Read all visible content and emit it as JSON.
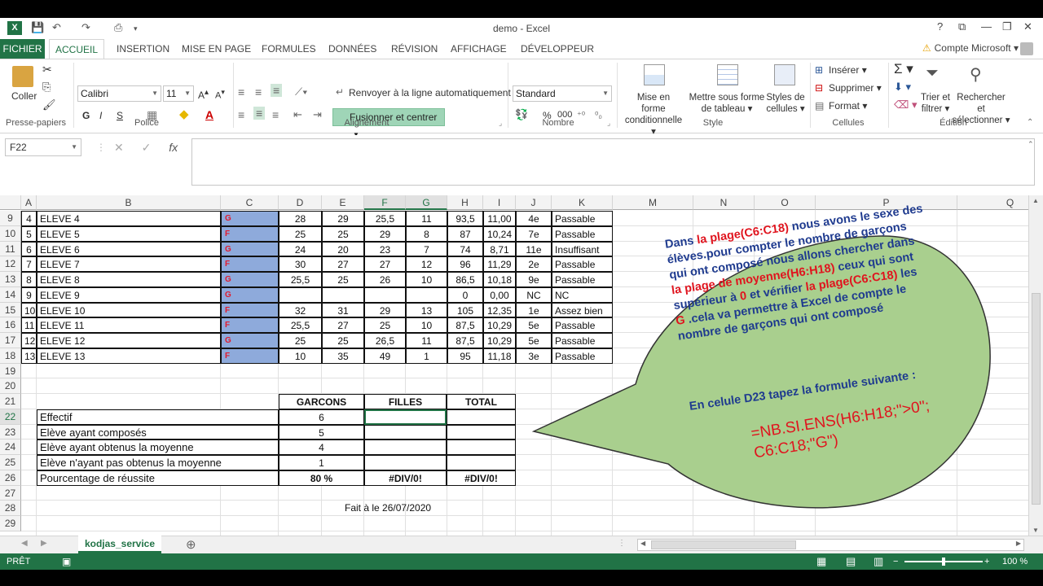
{
  "window": {
    "title": "demo - Excel",
    "help": "?",
    "min": "—",
    "restore": "❐",
    "close": "✕"
  },
  "tabs": {
    "file": "FICHIER",
    "items": [
      "ACCUEIL",
      "INSERTION",
      "MISE EN PAGE",
      "FORMULES",
      "DONNÉES",
      "RÉVISION",
      "AFFICHAGE",
      "DÉVELOPPEUR"
    ],
    "account": "Compte Microsoft"
  },
  "ribbon": {
    "paste": "Coller",
    "font_name": "Calibri",
    "font_size": "11",
    "bold": "G",
    "italic": "I",
    "underline": "S",
    "wrap": "Renvoyer à la ligne automatiquement",
    "merge": "Fusionner et centrer",
    "number_format": "Standard",
    "percent": "%",
    "thousands": "000",
    "cond_format_1": "Mise en forme",
    "cond_format_2": "conditionnelle",
    "table_format_1": "Mettre sous forme",
    "table_format_2": "de tableau",
    "cell_styles_1": "Styles de",
    "cell_styles_2": "cellules",
    "insert": "Insérer",
    "delete": "Supprimer",
    "format": "Format",
    "sort_1": "Trier et",
    "sort_2": "filtrer",
    "find_1": "Rechercher et",
    "find_2": "sélectionner",
    "groups": {
      "clipboard": "Presse-papiers",
      "font": "Police",
      "alignment": "Alignement",
      "number": "Nombre",
      "style": "Style",
      "cells": "Cellules",
      "editing": "Édition"
    }
  },
  "formula_bar": {
    "name_box": "F22",
    "fx": "fx",
    "content": ""
  },
  "columns": [
    "A",
    "B",
    "C",
    "D",
    "E",
    "F",
    "G",
    "H",
    "I",
    "J",
    "K",
    "M",
    "N",
    "O",
    "P",
    "Q"
  ],
  "rows": [
    {
      "n": "9",
      "a": "4",
      "b": "ELEVE 4",
      "c": "G",
      "d": "28",
      "e": "29",
      "f": "25,5",
      "g": "11",
      "h": "93,5",
      "i": "11,00",
      "j": "4e",
      "k": "Passable"
    },
    {
      "n": "10",
      "a": "5",
      "b": "ELEVE 5",
      "c": "F",
      "d": "25",
      "e": "25",
      "f": "29",
      "g": "8",
      "h": "87",
      "i": "10,24",
      "j": "7e",
      "k": "Passable"
    },
    {
      "n": "11",
      "a": "6",
      "b": "ELEVE 6",
      "c": "G",
      "d": "24",
      "e": "20",
      "f": "23",
      "g": "7",
      "h": "74",
      "i": "8,71",
      "j": "11e",
      "k": "Insuffisant"
    },
    {
      "n": "12",
      "a": "7",
      "b": "ELEVE 7",
      "c": "F",
      "d": "30",
      "e": "27",
      "f": "27",
      "g": "12",
      "h": "96",
      "i": "11,29",
      "j": "2e",
      "k": "Passable"
    },
    {
      "n": "13",
      "a": "8",
      "b": "ELEVE 8",
      "c": "G",
      "d": "25,5",
      "e": "25",
      "f": "26",
      "g": "10",
      "h": "86,5",
      "i": "10,18",
      "j": "9e",
      "k": "Passable"
    },
    {
      "n": "14",
      "a": "9",
      "b": "ELEVE 9",
      "c": "G",
      "d": "",
      "e": "",
      "f": "",
      "g": "",
      "h": "0",
      "i": "0,00",
      "j": "NC",
      "k": "NC"
    },
    {
      "n": "15",
      "a": "10",
      "b": "ELEVE 10",
      "c": "F",
      "d": "32",
      "e": "31",
      "f": "29",
      "g": "13",
      "h": "105",
      "i": "12,35",
      "j": "1e",
      "k": "Assez bien"
    },
    {
      "n": "16",
      "a": "11",
      "b": "ELEVE 11",
      "c": "F",
      "d": "25,5",
      "e": "27",
      "f": "25",
      "g": "10",
      "h": "87,5",
      "i": "10,29",
      "j": "5e",
      "k": "Passable"
    },
    {
      "n": "17",
      "a": "12",
      "b": "ELEVE 12",
      "c": "G",
      "d": "25",
      "e": "25",
      "f": "26,5",
      "g": "11",
      "h": "87,5",
      "i": "10,29",
      "j": "5e",
      "k": "Passable"
    },
    {
      "n": "18",
      "a": "13",
      "b": "ELEVE 13",
      "c": "F",
      "d": "10",
      "e": "35",
      "f": "49",
      "g": "1",
      "h": "95",
      "i": "11,18",
      "j": "3e",
      "k": "Passable"
    }
  ],
  "extra_rows": [
    "19",
    "20",
    "21",
    "22",
    "23",
    "24",
    "25",
    "26",
    "27",
    "28",
    "29"
  ],
  "summary": {
    "headers": [
      "GARCONS",
      "FILLES",
      "TOTAL"
    ],
    "rows": [
      {
        "label": "Effectif",
        "g": "6",
        "f": "",
        "t": ""
      },
      {
        "label": "Elève ayant composés",
        "g": "5",
        "f": "",
        "t": ""
      },
      {
        "label": "Elève ayant obtenus la moyenne",
        "g": "4",
        "f": "",
        "t": ""
      },
      {
        "label": "Elève n'ayant pas obtenus la moyenne",
        "g": "1",
        "f": "",
        "t": ""
      },
      {
        "label": "Pourcentage de réussite",
        "g": "80 %",
        "f": "#DIV/0!",
        "t": "#DIV/0!"
      }
    ],
    "footer": "Fait à   le 26/07/2020"
  },
  "bubble": {
    "line1a": "Dans ",
    "line1b": "la plage(C6:C18)",
    "line1c": " nous avons le sexe des",
    "line2": "élèves.pour compter le nombre de garçons",
    "line3": "qui  ont composé nous allons chercher dans",
    "line4a": "la plage de moyenne(H6:H18)",
    "line4b": " ceux qui sont",
    "line5a": "supérieur à ",
    "line5b": "0",
    "line5c": " et vérifier ",
    "line5d": "la plage(C6:C18)",
    "line5e": "  les",
    "line6a": "G",
    "line6b": " .cela va permettre à Excel de compte le",
    "line7": "nombre de garçons qui ont composé",
    "cmd": "En celule D23  tapez la formule suivante :",
    "formula1": "=NB.SI.ENS(H6:H18;\">0\";",
    "formula2": "C6:C18;\"G\")",
    "fill": "#a9cf8e",
    "text_color": "#1f3b8f",
    "highlight_color": "#e0141e"
  },
  "sheet": {
    "name": "kodjas_service",
    "add": "⊕"
  },
  "status": {
    "ready": "PRÊT",
    "zoom": "100 %"
  },
  "colors": {
    "excel_green": "#217346",
    "gender_fill": "#8eaadb"
  }
}
